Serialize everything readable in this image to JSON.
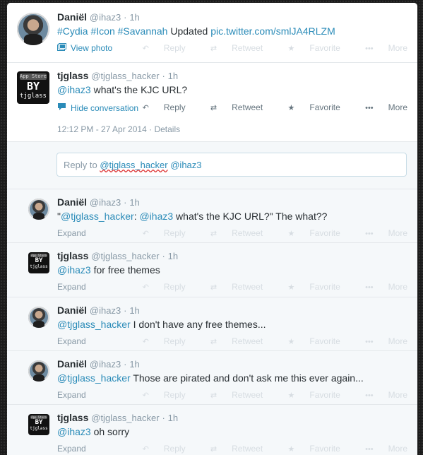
{
  "tweets": [
    {
      "name": "Daniël",
      "handle": "@ihaz3",
      "time": "1h",
      "text_parts": [
        "#Cydia",
        " ",
        "#Icon",
        " ",
        "#Savannah",
        " Updated ",
        "pic.twitter.com/smlJA4RLZM"
      ],
      "action_link": "View photo"
    },
    {
      "name": "tjglass",
      "handle": "@tjglass_hacker",
      "time": "1h",
      "mention": "@ihaz3",
      "text": " what's the KJC URL?",
      "action_link": "Hide conversation",
      "timestamp": "12:12 PM - 27 Apr 2014",
      "details": "Details",
      "avatar_top": "App Store",
      "avatar_by": "BY",
      "avatar_name": "tjglass"
    }
  ],
  "replybox": {
    "prefix": "Reply to ",
    "mention1": "@tjglass_hacker",
    "mention2": "@ihaz3"
  },
  "replies": [
    {
      "name": "Daniël",
      "handle": "@ihaz3",
      "time": "1h",
      "pre": "\"",
      "mention": "@tjglass_hacker",
      "mid": ": ",
      "mention2": "@ihaz3",
      "text": " what's the KJC URL?\" The what??",
      "expand": "Expand"
    },
    {
      "name": "tjglass",
      "handle": "@tjglass_hacker",
      "time": "1h",
      "mention": "@ihaz3",
      "text": " for free themes",
      "expand": "Expand"
    },
    {
      "name": "Daniël",
      "handle": "@ihaz3",
      "time": "1h",
      "mention": "@tjglass_hacker",
      "text": " I don't have any free themes...",
      "expand": "Expand"
    },
    {
      "name": "Daniël",
      "handle": "@ihaz3",
      "time": "1h",
      "mention": "@tjglass_hacker",
      "text": " Those are pirated and don't ask me this ever again...",
      "expand": "Expand"
    },
    {
      "name": "tjglass",
      "handle": "@tjglass_hacker",
      "time": "1h",
      "mention": "@ihaz3",
      "text": " oh sorry",
      "expand": "Expand"
    }
  ],
  "actions": {
    "reply": "Reply",
    "retweet": "Retweet",
    "favorite": "Favorite",
    "more": "More"
  },
  "colors": {
    "link": "#2a8bb8",
    "muted": "#8899a6",
    "background": "#1b1b1b"
  },
  "icons": {
    "reply": "reply-icon",
    "retweet": "retweet-icon",
    "favorite": "star-icon",
    "more": "more-icon",
    "photo": "photo-icon",
    "conversation": "speech-bubble-icon"
  }
}
